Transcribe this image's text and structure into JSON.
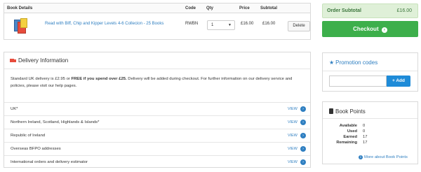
{
  "basket": {
    "headers": {
      "details": "Book Details",
      "code": "Code",
      "qty": "Qty",
      "price": "Price",
      "subtotal": "Subtotal"
    },
    "item": {
      "title": "Read with Biff, Chip and Kipper Levels 4-6 Collecion - 25 Books",
      "code": "RWBN",
      "qty": "1",
      "price": "£16.00",
      "subtotal": "£16.00",
      "delete_label": "Delete"
    }
  },
  "summary": {
    "subtotal_label": "Order Subtotal",
    "subtotal_value": "£16.00",
    "checkout_label": "Checkout"
  },
  "promo": {
    "title": "Promotion codes",
    "input_placeholder": "",
    "add_label": "+ Add"
  },
  "points": {
    "title": "Book Points",
    "rows": [
      {
        "label": "Available",
        "value": "0"
      },
      {
        "label": "Used",
        "value": "0"
      },
      {
        "label": "Earned",
        "value": "17"
      },
      {
        "label": "Remaining",
        "value": "17"
      }
    ],
    "more_link": "More about Book Points"
  },
  "delivery": {
    "title": "Delivery Information",
    "info_prefix": "Standard UK delivery is £2.95 or ",
    "info_bold": "FREE if you spend over £25.",
    "info_suffix": " Delivery will be added during checkout. For further information on our delivery service and policies, please visit our help pages.",
    "view_label": "VIEW",
    "regions": [
      "UK*",
      "Northern Ireland, Scotland, Highlands & Islands*",
      "Republic of Ireland",
      "Overseas BFPO addresses",
      "International orders and delivery estimator"
    ]
  },
  "colors": {
    "accent_blue": "#2f7fc1",
    "checkout_green": "#3daf4b",
    "subtotal_bg": "#dff0d8",
    "delivery_red": "#e74c3c"
  },
  "icons": {
    "delivery": "truck-icon",
    "promo": "star-icon",
    "points": "book-icon",
    "info": "info-circle-icon",
    "checkout": "arrow-circle-right-icon"
  }
}
